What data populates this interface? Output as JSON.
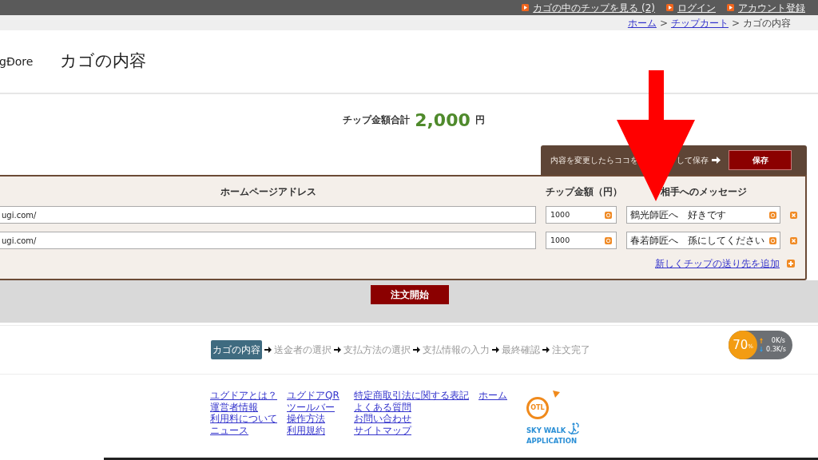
{
  "top_links": [
    "カゴの中のチップを見る (2)",
    "ログイン",
    "アカウント登録"
  ],
  "breadcrumb": {
    "items": [
      {
        "label": "ホーム",
        "kind": "link"
      },
      {
        "label": "チップカート",
        "kind": "link"
      },
      {
        "label": "カゴの内容",
        "kind": "current"
      }
    ],
    "separator": ">"
  },
  "logo": "gĐore",
  "page_title": "カゴの内容",
  "total": {
    "label": "チップ金額合計",
    "amount": "2,000",
    "unit": "円"
  },
  "save_bar": {
    "note_before": "内容を変更したらココを",
    "note_after": "して保存",
    "button": "保存"
  },
  "columns": [
    "ホームページアドレス",
    "チップ金額（円）",
    "相手へのメッセージ"
  ],
  "rows": [
    {
      "url": "ugi.com/",
      "amount": "1000",
      "message": "鶴光師匠へ　好きです"
    },
    {
      "url": "ugi.com/",
      "amount": "1000",
      "message": "春若師匠へ　孫にしてください"
    }
  ],
  "add_link": "新しくチップの送り先を追加",
  "order_button": "注文開始",
  "steps": [
    {
      "label": "カゴの内容",
      "selected": true
    },
    {
      "label": "送金者の選択",
      "selected": false
    },
    {
      "label": "支払方法の選択",
      "selected": false
    },
    {
      "label": "支払情報の入力",
      "selected": false
    },
    {
      "label": "最終確認",
      "selected": false
    },
    {
      "label": "注文完了",
      "selected": false
    }
  ],
  "speed_widget": {
    "percent": "70",
    "unit": "%",
    "upload": "0K/s",
    "download": "0.3K/s"
  },
  "footer_columns": [
    [
      "ユグドアとは？",
      "運営者情報",
      "利用料について",
      "ニュース"
    ],
    [
      "ユグドアQR",
      "ツールバー",
      "操作方法",
      "利用規約"
    ],
    [
      "特定商取引法に関する表記",
      "よくある質問",
      "お問い合わせ",
      "サイトマップ"
    ],
    [
      "ホーム"
    ]
  ],
  "app_logo": {
    "badge": "OTL",
    "line_1": "SKY WALK",
    "line_2": "APPLICATION"
  }
}
